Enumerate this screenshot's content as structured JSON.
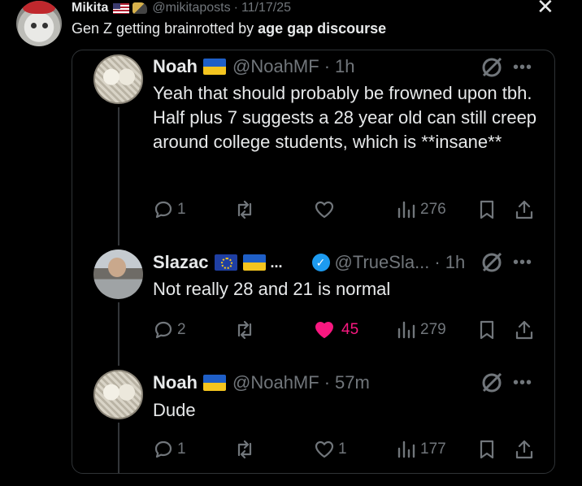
{
  "outer": {
    "name": "Mikita",
    "handle": "@mikitaposts",
    "date": "11/17/25",
    "text_prefix": "Gen Z getting brainrotted by ",
    "text_bold": "age gap discourse"
  },
  "posts": [
    {
      "name": "Noah",
      "handle": "@NoahMF",
      "time": "1h",
      "text": "Yeah that should probably be frowned upon tbh. Half plus 7 suggests a 28 year old can still creep around college students, which is **insane**",
      "replies": "1",
      "reposts": "",
      "likes": "",
      "views": "276",
      "liked": false
    },
    {
      "name": "Slazac",
      "name_suffix": "...",
      "handle": "@TrueSla...",
      "time": "1h",
      "text": "Not really 28 and 21 is normal",
      "replies": "2",
      "reposts": "",
      "likes": "45",
      "views": "279",
      "liked": true
    },
    {
      "name": "Noah",
      "handle": "@NoahMF",
      "time": "57m",
      "text": "Dude",
      "replies": "1",
      "reposts": "",
      "likes": "1",
      "views": "177",
      "liked": false
    }
  ],
  "icons": {
    "close": "close-icon",
    "reply": "reply-icon",
    "repost": "repost-icon",
    "like": "heart-icon",
    "views": "views-icon",
    "bookmark": "bookmark-icon",
    "share": "share-icon",
    "grok": "grok-icon",
    "more": "more-icon"
  },
  "colors": {
    "background": "#000000",
    "text": "#e7e9ea",
    "muted": "#71767b",
    "like": "#f91880",
    "verified": "#1d9bf0"
  }
}
